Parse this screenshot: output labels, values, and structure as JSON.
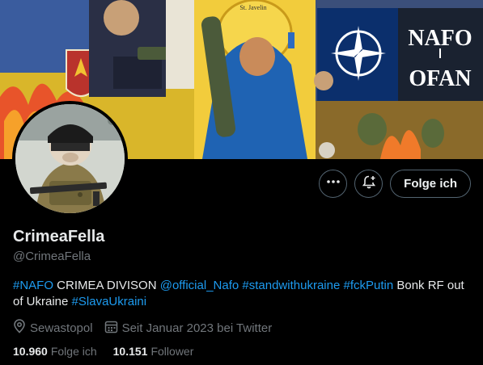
{
  "banner": {
    "nafo_sign_line1": "NAFO",
    "nafo_sign_line2": "OFAN",
    "icon_caption": "St. Javelin"
  },
  "profile": {
    "display_name": "CrimeaFella",
    "handle": "@CrimeaFella",
    "bio": [
      {
        "text": "#NAFO",
        "link": true
      },
      {
        "text": " CRIMEA DIVISON ",
        "link": false
      },
      {
        "text": "@official_Nafo",
        "link": true
      },
      {
        "text": " ",
        "link": false
      },
      {
        "text": "#standwithukraine",
        "link": true
      },
      {
        "text": " ",
        "link": false
      },
      {
        "text": "#fckPutin",
        "link": true
      },
      {
        "text": " Bonk RF out of Ukraine ",
        "link": false
      },
      {
        "text": "#SlavaUkraini",
        "link": true
      }
    ],
    "location": "Sewastopol",
    "joined": "Seit Januar 2023 bei Twitter",
    "following_count": "10.960",
    "following_label": "Folge ich",
    "followers_count": "10.151",
    "followers_label": "Follower"
  },
  "actions": {
    "more_icon": "more-icon",
    "notify_icon": "bell-plus-icon",
    "follow_label": "Folge ich"
  },
  "colors": {
    "link": "#1d9bf0",
    "muted": "#71767b",
    "text": "#e7e9ea",
    "background": "#000000"
  }
}
